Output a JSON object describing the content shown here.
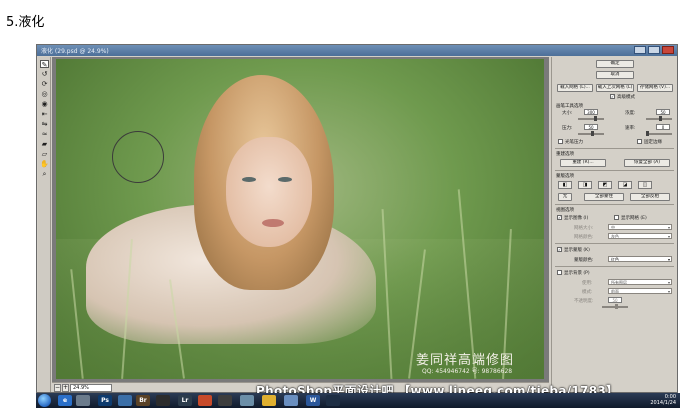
{
  "heading": "5.液化",
  "window": {
    "title": "液化 (29.psd @ 24.9%)"
  },
  "photo": {
    "watermark_cn": "姜同祥高端修图",
    "watermark_qq": "QQ: 454946742  号: 98786628"
  },
  "statusbar": {
    "zoom": "24.9%",
    "zoom_minus": "−",
    "zoom_plus": "+"
  },
  "panel": {
    "ok": "确定",
    "cancel": "取消",
    "load_mesh": "载入网格 (L)...",
    "load_last_mesh": "载入上次网格 (L)",
    "save_mesh": "存储网格 (V)...",
    "advanced_mode": "高级模式",
    "brush_options_title": "画笔工具选项",
    "size_label": "大小:",
    "size_value": "300",
    "density_label": "浓度:",
    "density_value": "50",
    "pressure_label": "压力:",
    "pressure_value": "50",
    "rate_label": "速率:",
    "rate_value": "0",
    "stylus_pressure": "光笔压力",
    "pin_edges": "固定边缘",
    "reconstruct_title": "重建选项",
    "reconstruct_btn": "重建 (R)...",
    "restore_all_btn": "恢复全部 (A)",
    "mask_title": "蒙版选项",
    "mask_none": "无",
    "mask_all": "全部蒙住",
    "mask_invert": "全部反相",
    "view_title": "视图选项",
    "show_image": "显示图像 (I)",
    "show_mesh": "显示网格 (E)",
    "mesh_size_label": "网格大小:",
    "mesh_size_value": "中",
    "mesh_color_label": "网格颜色:",
    "mesh_color_value": "灰色",
    "show_mask": "显示蒙版 (K)",
    "mask_color_label": "蒙版颜色:",
    "mask_color_value": "红色",
    "show_backdrop": "显示背景 (P)",
    "use_label": "使用:",
    "use_value": "所有图层",
    "mode_label": "模式:",
    "mode_value": "前面",
    "opacity_label": "不透明度:",
    "opacity_value": "50"
  },
  "banner": "PhotoShop平面设计吧 【www.lineeg.com/tieba/1783】",
  "taskbar": {
    "apps": [
      "e",
      "Ps",
      "Br",
      "Lr",
      "W"
    ],
    "time": "0:00",
    "date": "2014/1/24"
  },
  "colors": {
    "titlebar": "#5a7da6",
    "panel_bg": "#d4d0c8",
    "taskbar": "#1a2740"
  }
}
